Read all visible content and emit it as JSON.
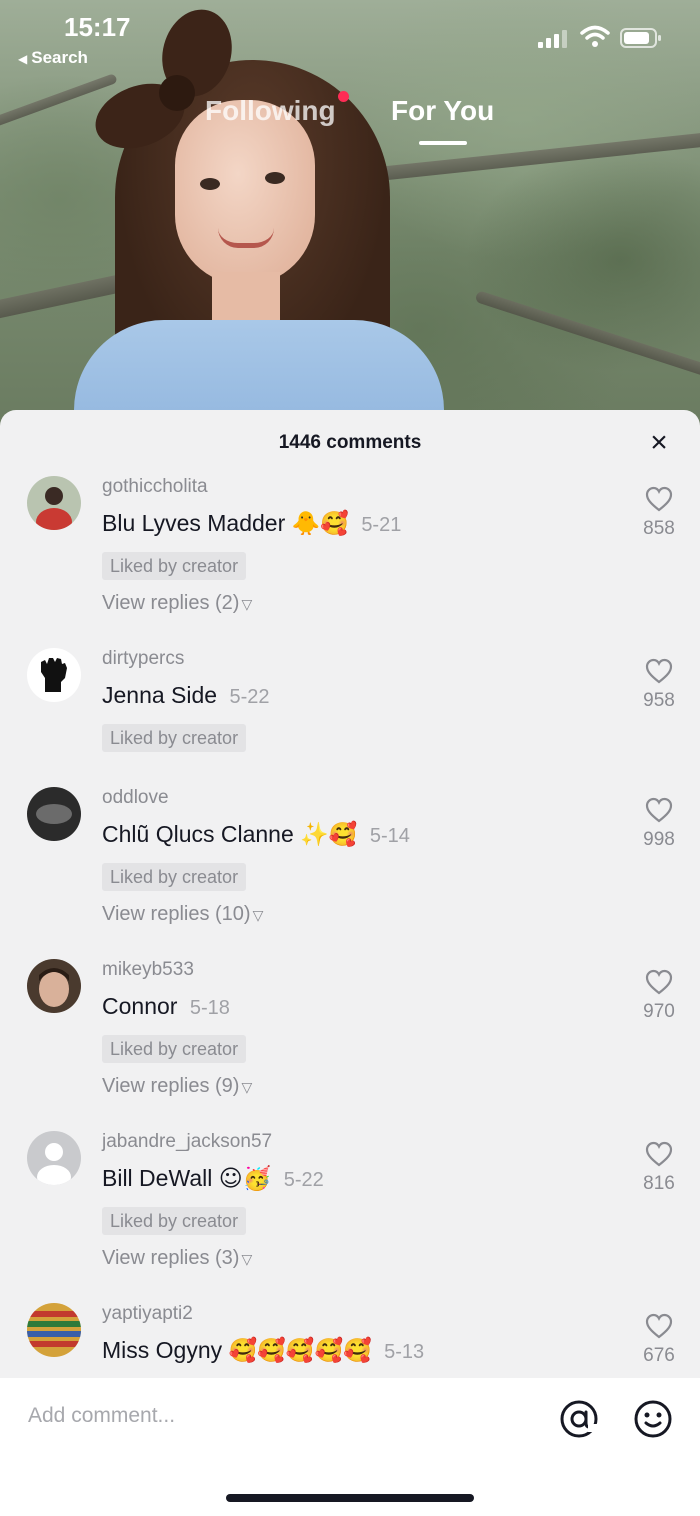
{
  "status_bar": {
    "time": "15:17",
    "back_label": "Search"
  },
  "top_tabs": {
    "following": "Following",
    "for_you": "For You"
  },
  "comments_sheet": {
    "count_label": "1446 comments",
    "close_symbol": "×",
    "comments": [
      {
        "username": "gothiccholita",
        "text": "Blu Lyves Madder",
        "emojis": "🐥🥰",
        "date": "5-21",
        "liked_by_creator": "Liked by creator",
        "view_replies": "View replies (2)",
        "likes": "858"
      },
      {
        "username": "dirtypercs",
        "text": "Jenna Side",
        "emojis": "",
        "date": "5-22",
        "liked_by_creator": "Liked by creator",
        "view_replies": "",
        "likes": "958"
      },
      {
        "username": "oddlove",
        "text": "Chlũ Qlucs Clanne",
        "emojis": "✨🥰",
        "date": "5-14",
        "liked_by_creator": "Liked by creator",
        "view_replies": "View replies (10)",
        "likes": "998"
      },
      {
        "username": "mikeyb533",
        "text": "Connor",
        "emojis": "",
        "date": "5-18",
        "liked_by_creator": "Liked by creator",
        "view_replies": "View replies (9)",
        "likes": "970"
      },
      {
        "username": "jabandre_jackson57",
        "text": "Bill DeWall",
        "emojis": "☺🥳",
        "date": "5-22",
        "liked_by_creator": "Liked by creator",
        "view_replies": "View replies (3)",
        "likes": "816"
      },
      {
        "username": "yaptiyapti2",
        "text": "Miss Ogyny",
        "emojis": "🥰🥰🥰🥰🥰",
        "date": "5-13",
        "liked_by_creator": "",
        "view_replies": "",
        "likes": "676"
      }
    ]
  },
  "composer": {
    "placeholder": "Add comment...",
    "at_icon": "at-icon",
    "emoji_icon": "emoji-face-icon"
  },
  "colors": {
    "accent_dot": "#fe2c55",
    "sheet_bg": "#f1f1f2",
    "muted_text": "#8a8b91"
  }
}
